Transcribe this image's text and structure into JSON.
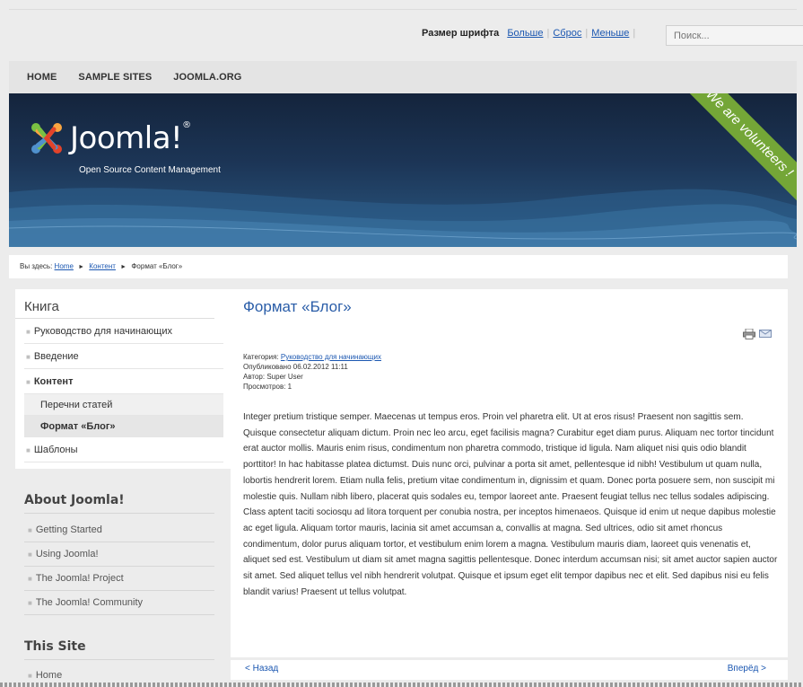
{
  "topbar": {
    "fontsize_label": "Размер шрифта",
    "bigger": "Больше",
    "reset": "Сброс",
    "smaller": "Меньше",
    "search_placeholder": "Поиск..."
  },
  "nav": {
    "items": [
      "HOME",
      "SAMPLE SITES",
      "JOOMLA.ORG"
    ]
  },
  "header": {
    "logo_text": "Joomla!",
    "logo_tm": "®",
    "tagline": "Open Source Content Management",
    "ribbon": "We are volunteers !",
    "brand_colors": {
      "red": "#e2432a",
      "orange": "#f9a541",
      "green": "#7ac143",
      "blue": "#5091cd",
      "ribbon": "#74a637"
    }
  },
  "breadcrumb": {
    "prefix": "Вы здесь:",
    "home": "Home",
    "content": "Контент",
    "current": "Формат «Блог»"
  },
  "sidebar": {
    "title": "Книга",
    "items": [
      {
        "label": "Руководство для начинающих"
      },
      {
        "label": "Введение"
      },
      {
        "label": "Контент"
      },
      {
        "label": "Перечни статей"
      },
      {
        "label": "Формат «Блог»"
      },
      {
        "label": "Шаблоны"
      }
    ],
    "about_title": "About Joomla!",
    "about_items": [
      "Getting Started",
      "Using Joomla!",
      "The Joomla! Project",
      "The Joomla! Community"
    ],
    "site_title": "This Site",
    "site_items": [
      "Home"
    ]
  },
  "article": {
    "title": "Формат «Блог»",
    "category_label": "Категория:",
    "category": "Руководство для начинающих",
    "published": "Опубликовано 06.02.2012 11:11",
    "author": "Автор: Super User",
    "views": "Просмотров: 1",
    "body": "Integer pretium tristique semper. Maecenas ut tempus eros. Proin vel pharetra elit. Ut at eros risus! Praesent non sagittis sem. Quisque consectetur aliquam dictum. Proin nec leo arcu, eget facilisis magna? Curabitur eget diam purus. Aliquam nec tortor tincidunt erat auctor mollis. Mauris enim risus, condimentum non pharetra commodo, tristique id ligula. Nam aliquet nisi quis odio blandit porttitor! In hac habitasse platea dictumst. Duis nunc orci, pulvinar a porta sit amet, pellentesque id nibh! Vestibulum ut quam nulla, lobortis hendrerit lorem. Etiam nulla felis, pretium vitae condimentum in, dignissim et quam. Donec porta posuere sem, non suscipit mi molestie quis. Nullam nibh libero, placerat quis sodales eu, tempor laoreet ante. Praesent feugiat tellus nec tellus sodales adipiscing. Class aptent taciti sociosqu ad litora torquent per conubia nostra, per inceptos himenaeos. Quisque id enim ut neque dapibus molestie ac eget ligula. Aliquam tortor mauris, lacinia sit amet accumsan a, convallis at magna. Sed ultrices, odio sit amet rhoncus condimentum, dolor purus aliquam tortor, et vestibulum enim lorem a magna. Vestibulum mauris diam, laoreet quis venenatis et, aliquet sed est. Vestibulum ut diam sit amet magna sagittis pellentesque. Donec interdum accumsan nisi; sit amet auctor sapien auctor sit amet. Sed aliquet tellus vel nibh hendrerit volutpat. Quisque et ipsum eget elit tempor dapibus nec et elit. Sed dapibus nisi eu felis blandit varius! Praesent ut tellus volutpat."
  },
  "pager": {
    "prev": "< Назад",
    "next": "Вперёд >"
  },
  "icons": {
    "print": "print-icon",
    "email": "email-icon"
  }
}
